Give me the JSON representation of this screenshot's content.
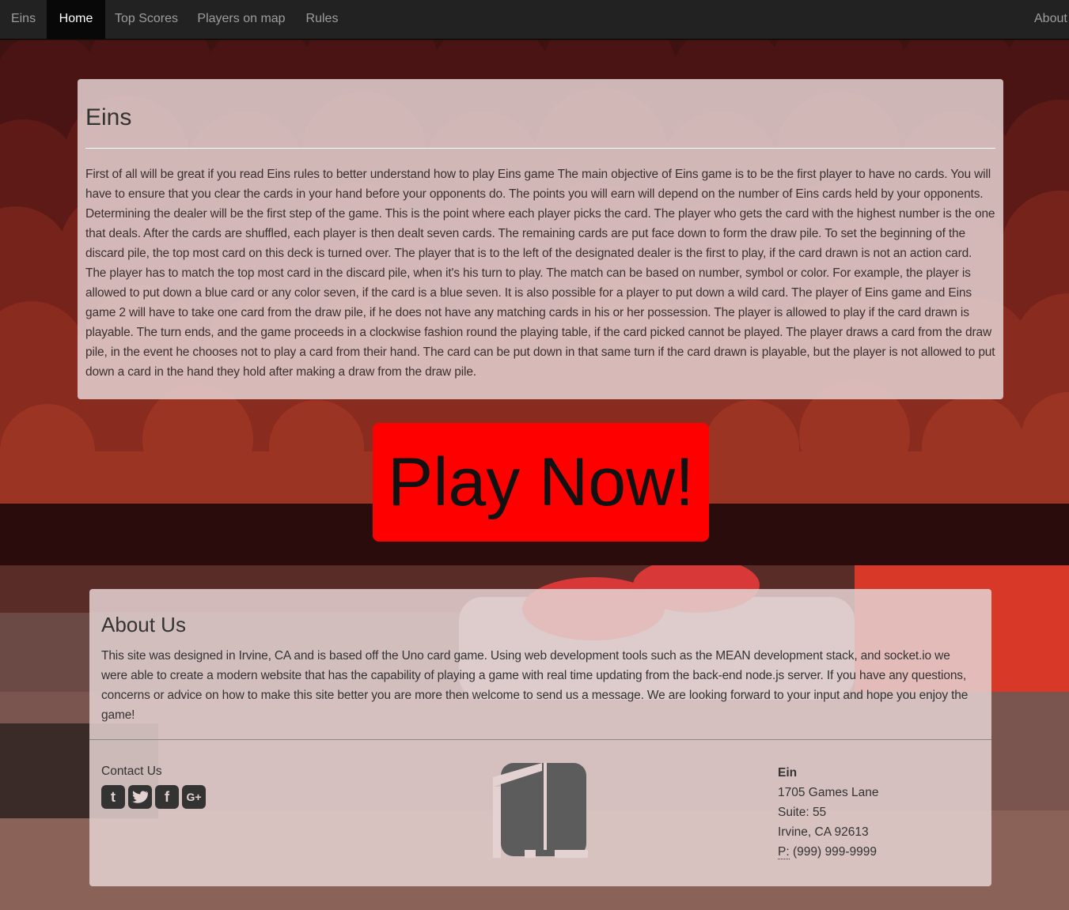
{
  "nav": {
    "brand": "Eins",
    "home": "Home",
    "top_scores": "Top Scores",
    "players_on_map": "Players on map",
    "rules": "Rules",
    "about": "About"
  },
  "intro": {
    "title": "Eins",
    "text": "First of all will be great if you read Eins rules to better understand how to play Eins game The main objective of Eins game is to be the first player to have no cards. You will have to ensure that you clear the cards in your hand before your opponents do. The points you will earn will depend on the number of Eins cards held by your opponents. Determining the dealer will be the first step of the game. This is the point where each player picks the card. The player who gets the card with the highest number is the one that deals. After the cards are shuffled, each player is then dealt seven cards. The remaining cards are put face down to form the draw pile. To set the beginning of the discard pile, the top most card on this deck is turned over. The player that is to the left of the designated dealer is the first to play, if the card drawn is not an action card. The player has to match the top most card in the discard pile, when it's his turn to play. The match can be based on number, symbol or color. For example, the player is allowed to put down a blue card or any color seven, if the card is a blue seven. It is also possible for a player to put down a wild card. The player of Eins game and Eins game 2 will have to take one card from the draw pile, if he does not have any matching cards in his or her possession. The player is allowed to play if the card drawn is playable. The turn ends, and the game proceeds in a clockwise fashion round the playing table, if the card picked cannot be played. The player draws a card from the draw pile, in the event he chooses not to play a card from their hand. The card can be put down in that same turn if the card drawn is playable, but the player is not allowed to put down a card in the hand they hold after making a draw from the draw pile."
  },
  "play_button": "Play Now!",
  "about": {
    "title": "About Us",
    "text": "This site was designed in Irvine, CA and is based off the Uno card game. Using web development tools such as the MEAN development stack, and socket.io we were able to create a modern website that has the capability of playing a game with real time updating from the back-end node.js server. If you have any questions, concerns or advice on how to make this site better you are more then welcome to send us a message. We are looking forward to your input and hope you enjoy the game!",
    "contact_label": "Contact Us",
    "social_icons": [
      "tumblr-icon",
      "twitter-icon",
      "facebook-icon",
      "google-plus-icon"
    ]
  },
  "address": {
    "name": "Ein",
    "street": "1705 Games Lane",
    "suite": "Suite: 55",
    "city": "Irvine, CA 92613",
    "phone_label": "P:",
    "phone": "(999) 999-9999"
  },
  "colors": {
    "navbar": "#222222",
    "play_button": "#ff0000",
    "hero_dark": "#3f1212",
    "hero_clouds": "#9a3323"
  }
}
